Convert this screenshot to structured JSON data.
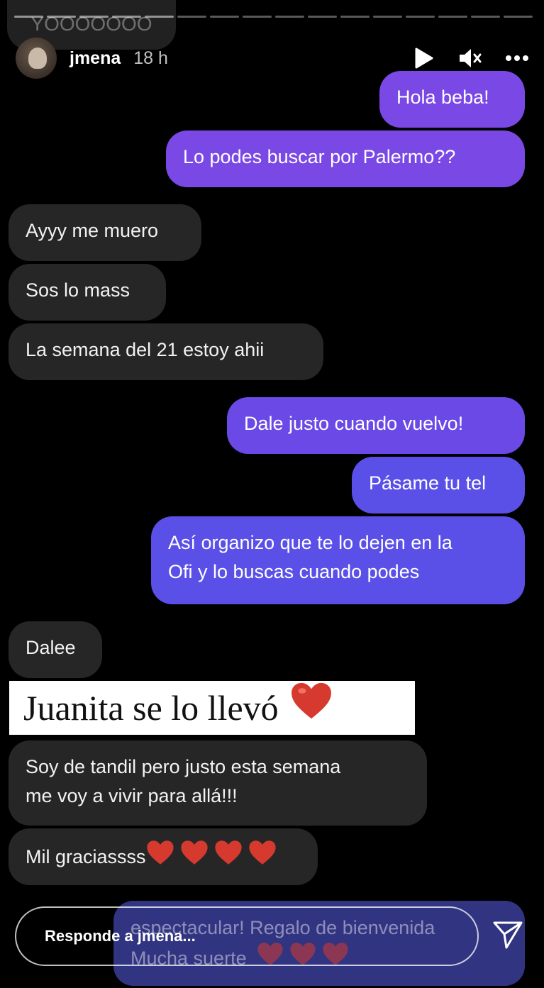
{
  "story": {
    "progress_segments": 16,
    "progress_done": 5,
    "ghost_text": "YOOOOOOO"
  },
  "header": {
    "username": "jmena",
    "time": "18 h",
    "icons": [
      "play-icon",
      "mute-icon",
      "more-icon"
    ]
  },
  "messages": {
    "m1": "Hola beba!",
    "m2": "Lo podes buscar por Palermo??",
    "m3": "Ayyy me muero",
    "m4": "Sos lo mass",
    "m5": "La semana del 21 estoy ahii",
    "m6": "Dale justo cuando vuelvo!",
    "m7": "Pásame tu tel",
    "m8_line1": "Así organizo que te lo dejen en la",
    "m8_line2": "Ofi y lo buscas cuando podes",
    "m9": "Dalee",
    "m10_line1": "Soy de tandil pero justo esta semana",
    "m10_line2": "me voy a vivir para allá!!!",
    "m11": "Mil graciassss"
  },
  "sticker": {
    "text": "Juanita se lo llevó"
  },
  "overlay": {
    "line1": "espectacular! Regalo de bienvenida",
    "line2": "Mucha suerte"
  },
  "reply": {
    "placeholder": "Responde a jmena..."
  },
  "colors": {
    "sent_top": "#7a48e4",
    "sent_bottom": "#5a50e8",
    "received": "#262626",
    "heart": "#d63a2f"
  }
}
